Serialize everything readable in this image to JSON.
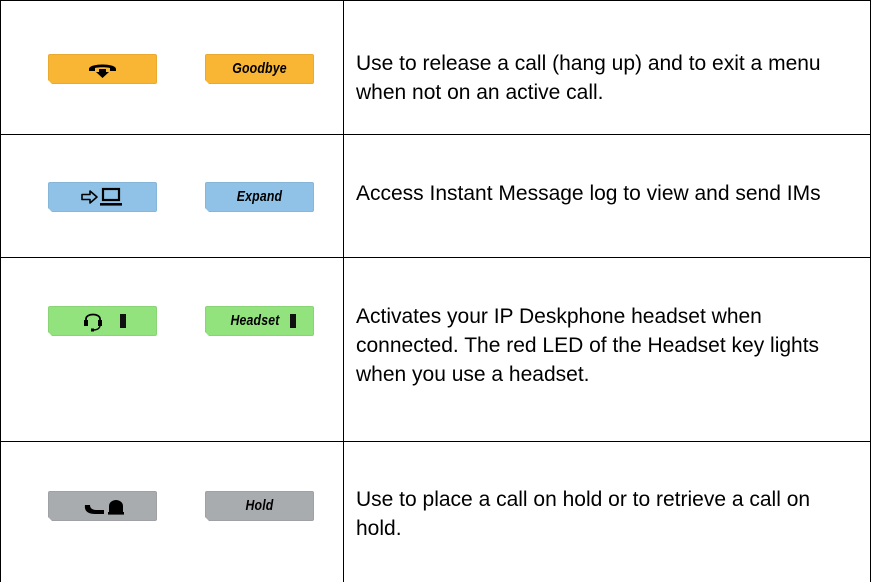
{
  "colors": {
    "goodbye_key": "#f9b534",
    "expand_key": "#8fc2e6",
    "headset_key": "#92e37e",
    "hold_key": "#a9acaf",
    "grid": "#000000"
  },
  "rows": [
    {
      "icon_key": {
        "icon": "hang-up-icon"
      },
      "label_key": {
        "label": "Goodbye"
      },
      "description": "Use to release a call (hang up) and to exit a menu when not on an active call."
    },
    {
      "icon_key": {
        "icon": "expand-to-screen-icon"
      },
      "label_key": {
        "label": "Expand"
      },
      "description": "Access Instant Message log to view and send IMs"
    },
    {
      "icon_key": {
        "icon": "headset-icon",
        "led_icon": "led-indicator-icon"
      },
      "label_key": {
        "label": "Headset"
      },
      "description": "Activates your IP Deskphone headset when connected. The red LED of the Headset key lights when you use a headset."
    },
    {
      "icon_key": {
        "icon": "hold-icon"
      },
      "label_key": {
        "label": "Hold"
      },
      "description": "Use to place a call on hold or to retrieve a call on hold."
    }
  ]
}
